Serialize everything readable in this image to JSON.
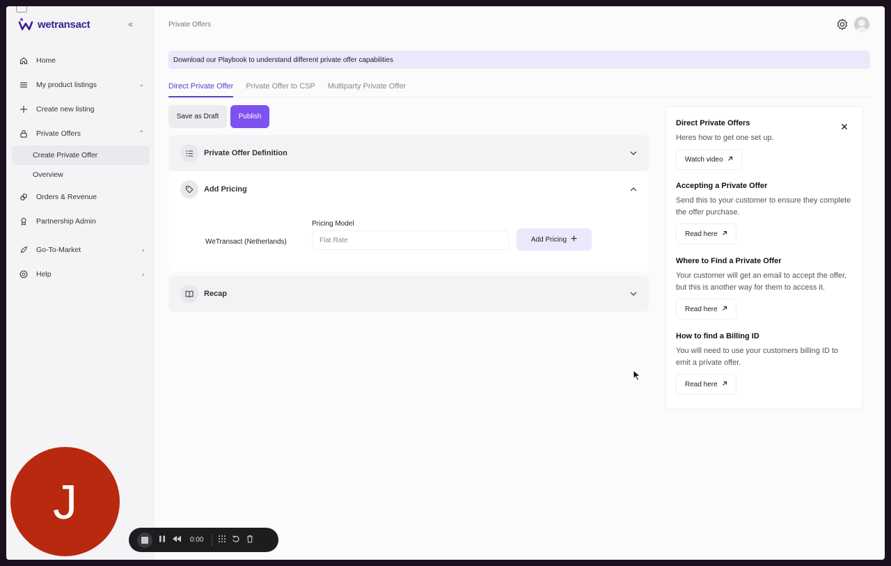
{
  "app": {
    "logo_text": "wetransact",
    "brand_color": "#7b3fe4"
  },
  "sidebar": {
    "items": [
      {
        "label": "Home",
        "icon": "home-icon"
      },
      {
        "label": "My product listings",
        "icon": "list-icon"
      },
      {
        "label": "Create new listing",
        "icon": "plus-icon"
      },
      {
        "label": "Private Offers",
        "icon": "lock-icon"
      },
      {
        "label": "Orders & Revenue",
        "icon": "link-icon"
      },
      {
        "label": "Partnership Admin",
        "icon": "award-icon"
      },
      {
        "label": "Go-To-Market",
        "icon": "rocket-icon"
      },
      {
        "label": "Help",
        "icon": "help-icon"
      }
    ],
    "sub_items": [
      {
        "label": "Create Private Offer",
        "active": true
      },
      {
        "label": "Overview",
        "active": false
      }
    ]
  },
  "header": {
    "breadcrumb": "Private Offers"
  },
  "banner": {
    "text": "Download our Playbook to understand different private offer capabilities"
  },
  "tabs": [
    {
      "label": "Direct Private Offer",
      "active": true
    },
    {
      "label": "Private Offer to CSP",
      "active": false
    },
    {
      "label": "Multiparty Private Offer",
      "active": false
    }
  ],
  "actions": {
    "save_draft": "Save as Draft",
    "publish": "Publish",
    "accent": "#7e52f0"
  },
  "sections": {
    "definition": "Private Offer Definition",
    "pricing": "Add Pricing",
    "recap": "Recap"
  },
  "pricing": {
    "entity": "WeTransact (Netherlands)",
    "model_label": "Pricing Model",
    "model_placeholder": "Flat Rate",
    "add_button": "Add Pricing"
  },
  "help_panel": {
    "title": "Direct Private Offers",
    "subtitle": "Heres how to get one set up.",
    "watch_video": "Watch video",
    "sections": [
      {
        "title": "Accepting a Private Offer",
        "text": "Send this to your customer to ensure they complete the offer purchase.",
        "link": "Read here"
      },
      {
        "title": "Where to Find a Private Offer",
        "text": "Your customer will get an email to accept the offer, but this is another way for them to access it.",
        "link": "Read here"
      },
      {
        "title": "How to find a Billing ID",
        "text": "You will need to use your customers billing ID to emit a private offer.",
        "link": "Read here"
      }
    ]
  },
  "recorder": {
    "initial": "J",
    "time": "0:00",
    "avatar_color": "#b9290f"
  }
}
